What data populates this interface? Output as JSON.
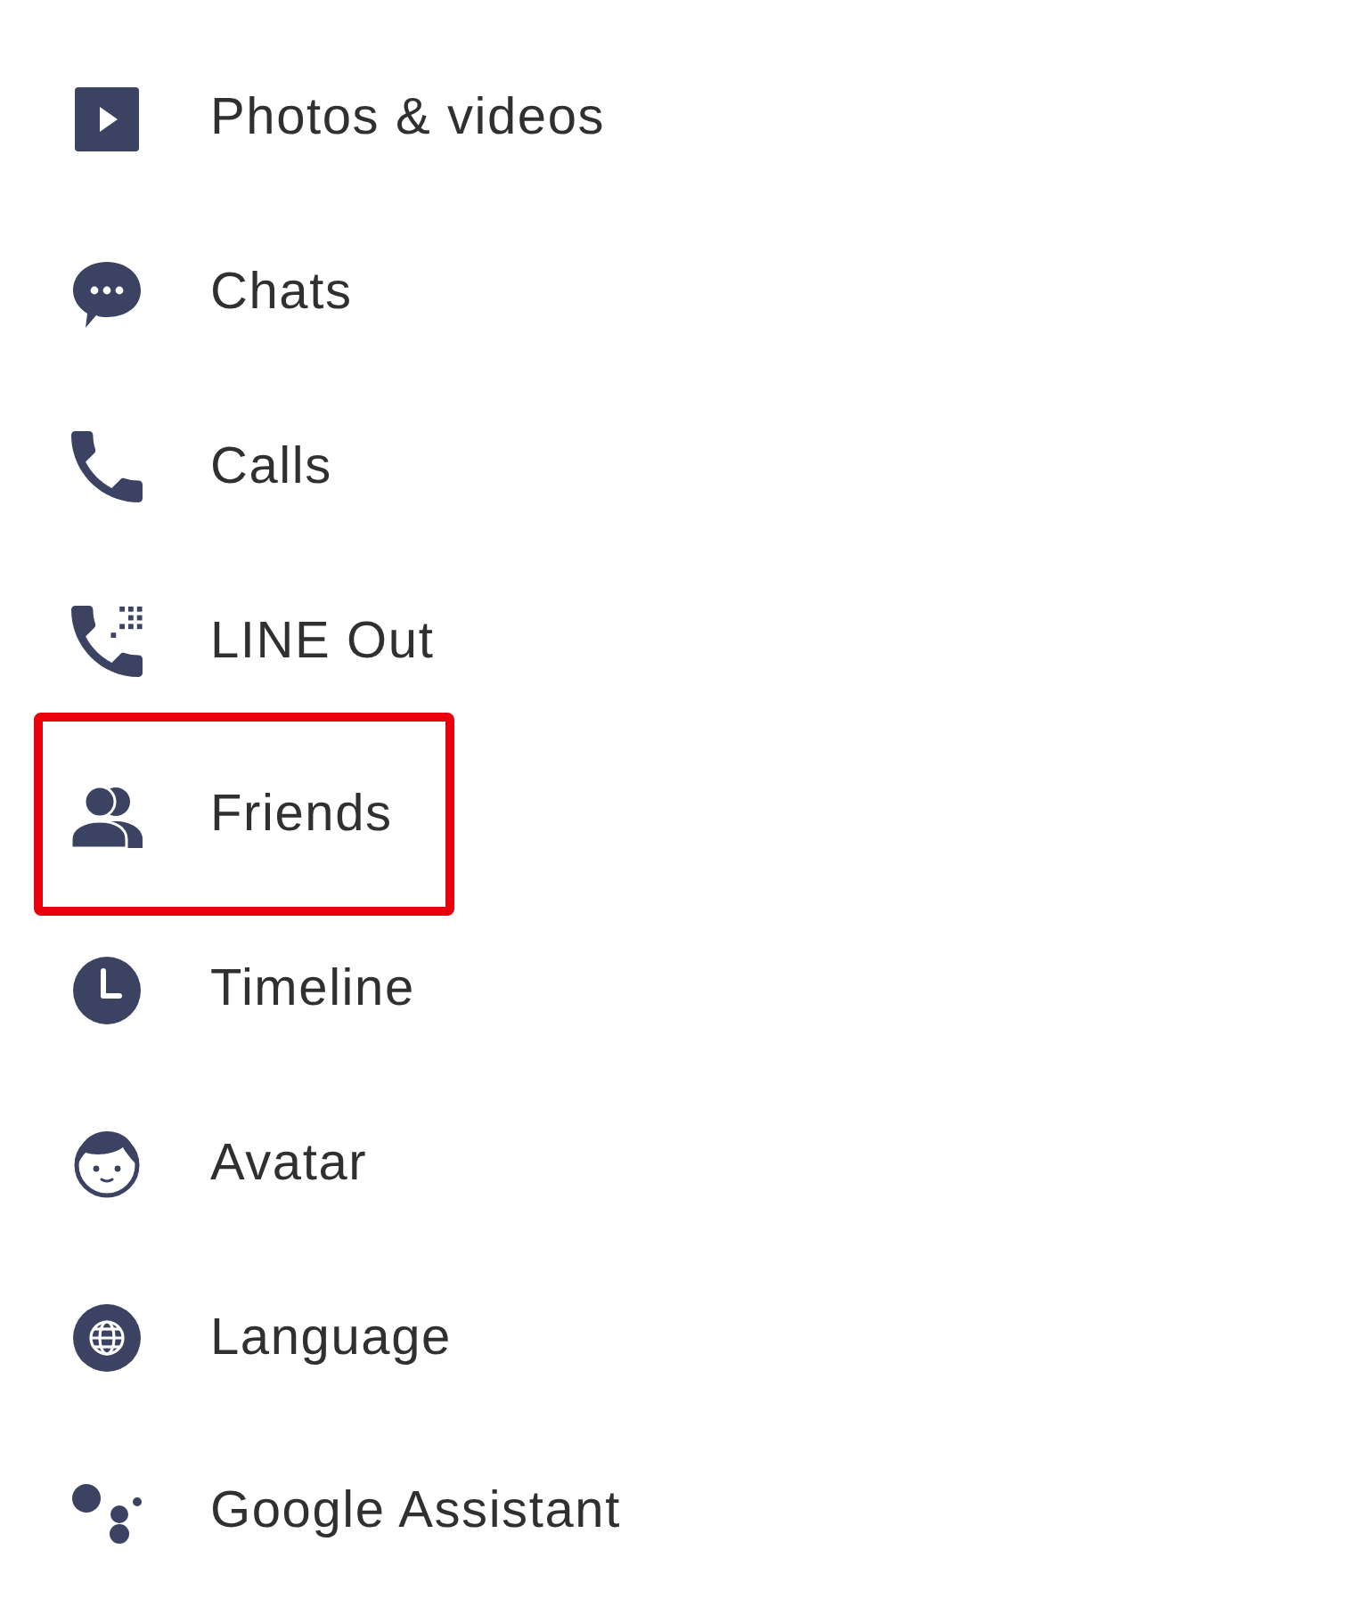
{
  "menu": {
    "items": [
      {
        "kind": "video",
        "label": "Photos & videos",
        "highlighted": false
      },
      {
        "kind": "chat",
        "label": "Chats",
        "highlighted": false
      },
      {
        "kind": "call",
        "label": "Calls",
        "highlighted": false
      },
      {
        "kind": "lineout",
        "label": "LINE Out",
        "highlighted": false
      },
      {
        "kind": "friends",
        "label": "Friends",
        "highlighted": true
      },
      {
        "kind": "timeline",
        "label": "Timeline",
        "highlighted": false
      },
      {
        "kind": "avatar",
        "label": "Avatar",
        "highlighted": false
      },
      {
        "kind": "language",
        "label": "Language",
        "highlighted": false
      },
      {
        "kind": "assistant",
        "label": "Google Assistant",
        "highlighted": false
      }
    ]
  }
}
